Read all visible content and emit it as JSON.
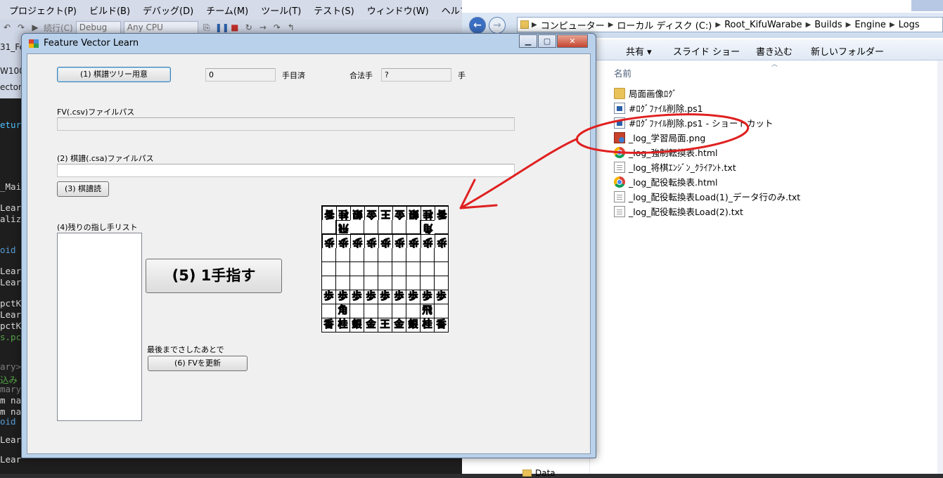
{
  "vs": {
    "menu": [
      "プロジェクト(P)",
      "ビルド(B)",
      "デバッグ(D)",
      "チーム(M)",
      "ツール(T)",
      "テスト(S)",
      "ウィンドウ(W)",
      "ヘルプ(H"
    ],
    "toolbar": {
      "continue": "続行(C)",
      "config": "Debug",
      "platform": "Any CPU"
    },
    "tabs": [
      "31_Fe",
      "W100_",
      "ectorL"
    ],
    "code_lines": [
      "eturn",
      "_Mai",
      "Lear",
      "aliz",
      "oid",
      "Lear",
      "Lear",
      "pctK",
      "Lear",
      "pctK",
      "s.pc",
      "ary>",
      "込み",
      "mary",
      "m na",
      "m na",
      "oid",
      "Lear",
      "Lear"
    ]
  },
  "explorer": {
    "breadcrumb": [
      "コンピューター",
      "ローカル ディスク (C:)",
      "Root_KifuWarabe",
      "Builds",
      "Engine",
      "Logs"
    ],
    "commands": [
      "共有 ▾",
      "スライド ショー",
      "書き込む",
      "新しいフォルダー"
    ],
    "column_header": "名前",
    "files": [
      {
        "name": "局面画像ﾛｸﾞ",
        "icon": "folder-icon"
      },
      {
        "name": "#ﾛｸﾞﾌｧｲﾙ削除.ps1",
        "icon": "powershell-icon"
      },
      {
        "name": "#ﾛｸﾞﾌｧｲﾙ削除.ps1 - ショートカット",
        "icon": "shortcut-icon"
      },
      {
        "name": "_log_学習局面.png",
        "icon": "png-image-icon"
      },
      {
        "name": "_log_強制転換表.html",
        "icon": "chrome-icon"
      },
      {
        "name": "_log_将棋ｴﾝｼﾞﾝ_ｸﾗｲｱﾝﾄ.txt",
        "icon": "text-file-icon"
      },
      {
        "name": "_log_配役転換表.html",
        "icon": "chrome-icon"
      },
      {
        "name": "_log_配役転換表Load(1)_データ行のみ.txt",
        "icon": "text-file-icon"
      },
      {
        "name": "_log_配役転換表Load(2).txt",
        "icon": "text-file-icon"
      }
    ],
    "nav_tree": [
      "Data"
    ]
  },
  "app": {
    "title": "Feature Vector Learn",
    "btn_prepare_tree": "(1) 棋譜ツリー用意",
    "moves_done_value": "0",
    "moves_done_label": "手目済",
    "legal_moves_label": "合法手",
    "legal_moves_value": "?",
    "legal_moves_unit": "手",
    "fv_path_label": "FV(.csv)ファイルパス",
    "fv_path_value": "",
    "kifu_path_label": "(2) 棋譜(.csa)ファイルパス",
    "kifu_path_value": "",
    "btn_read_kifu": "(3) 棋譜読",
    "remaining_moves_label": "(4)残りの指し手リスト",
    "btn_make_move": "(5) 1手指す",
    "after_end_label": "最後までさしたあとで",
    "btn_update_fv": "(6) FVを更新"
  },
  "board": {
    "rows": [
      [
        "香",
        "桂",
        "銀",
        "金",
        "王",
        "金",
        "銀",
        "桂",
        "香"
      ],
      [
        "",
        "飛",
        "",
        "",
        "",
        "",
        "",
        "角",
        ""
      ],
      [
        "歩",
        "歩",
        "歩",
        "歩",
        "歩",
        "歩",
        "歩",
        "歩",
        "歩"
      ],
      [
        "",
        "",
        "",
        "",
        "",
        "",
        "",
        "",
        ""
      ],
      [
        "",
        "",
        "",
        "",
        "",
        "",
        "",
        "",
        ""
      ],
      [
        "",
        "",
        "",
        "",
        "",
        "",
        "",
        "",
        ""
      ],
      [
        "歩",
        "歩",
        "歩",
        "歩",
        "歩",
        "歩",
        "歩",
        "歩",
        "歩"
      ],
      [
        "",
        "角",
        "",
        "",
        "",
        "",
        "",
        "飛",
        ""
      ],
      [
        "香",
        "桂",
        "銀",
        "金",
        "王",
        "金",
        "銀",
        "桂",
        "香"
      ]
    ],
    "gote_rows": [
      0,
      1,
      2
    ]
  },
  "annotation_colors": {
    "arrow": "#e02020",
    "ellipse": "#e02020"
  }
}
